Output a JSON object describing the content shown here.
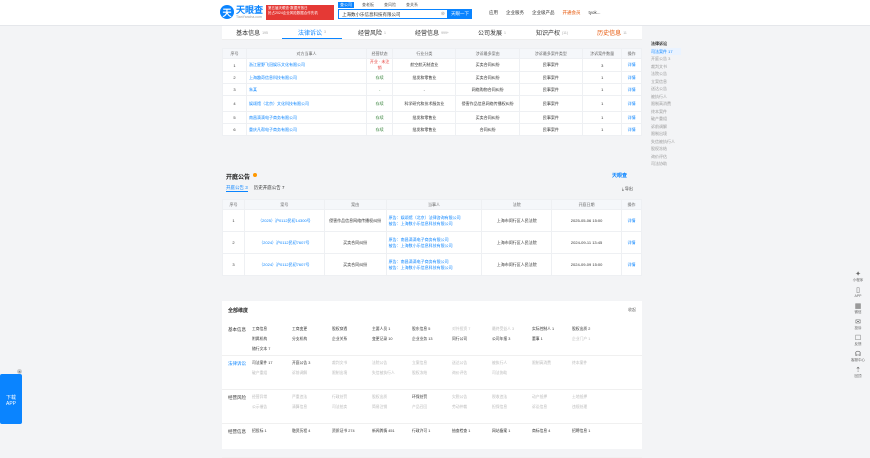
{
  "header": {
    "logo_name": "天眼查",
    "logo_domain": "TianYancha.com",
    "promo_line1": "第五届天眼查·数据开放日",
    "promo_line2": "抢占2024企业风险数据合作先机",
    "search_tabs": [
      "查公司",
      "查老板",
      "查风险",
      "查关系"
    ],
    "search_value": "上海数小乐信息科技有限公司",
    "search_btn": "天眼一下",
    "nav": [
      "应用",
      "企业服务",
      "企业级产品",
      "开通会员",
      "tyok..."
    ]
  },
  "tabs": [
    {
      "label": "基本信息",
      "count": "195"
    },
    {
      "label": "法律诉讼",
      "count": "3"
    },
    {
      "label": "经营风险",
      "count": "1"
    },
    {
      "label": "经营信息",
      "count": "999+"
    },
    {
      "label": "公司发展",
      "count": "1"
    },
    {
      "label": "知识产权",
      "count": "(11)"
    },
    {
      "label": "历史信息",
      "count": "11"
    }
  ],
  "lawsuit_table": {
    "headers": [
      "序号",
      "对方当事人",
      "经营状态",
      "行业分类",
      "涉诉最多案由",
      "涉诉最多案件类型",
      "涉诉案件数量",
      "操作"
    ],
    "rows": [
      [
        "1",
        "浙江星野飞冠娱乐文化有限公司",
        "开业 · 未注销",
        "航空航天制造业",
        "买卖合同纠纷",
        "民事案件",
        "3",
        "详情"
      ],
      [
        "2",
        "上海趣奇信息科技有限公司",
        "存续",
        "批发和零售业",
        "买卖合同纠纷",
        "民事案件",
        "1",
        "详情"
      ],
      [
        "3",
        "朱某",
        "-",
        "-",
        "网络购物合同纠纷",
        "民事案件",
        "1",
        "详情"
      ],
      [
        "4",
        "娱颂馆（北京）文化科技有限公司",
        "存续",
        "科学研究和技术服务业",
        "侵害作品信息网络传播权纠纷",
        "民事案件",
        "1",
        "详情"
      ],
      [
        "5",
        "南昌滴滴电子商务有限公司",
        "存续",
        "批发和零售业",
        "买卖合同纠纷",
        "民事案件",
        "1",
        "详情"
      ],
      [
        "6",
        "重庆凡帮电子商务有限公司",
        "存续",
        "批发和零售业",
        "合同纠纷",
        "民事案件",
        "1",
        "详情"
      ]
    ]
  },
  "court": {
    "title": "开庭公告",
    "subtabs": [
      "开庭公告 3",
      "历史开庭公告 7"
    ],
    "logo": "天眼查",
    "export": "导出",
    "headers": [
      "序号",
      "案号",
      "案由",
      "当事人",
      "法院",
      "开庭日期",
      "操作"
    ],
    "rows": [
      {
        "no": "1",
        "case": "（2025）沪0112民初14300号",
        "reason": "侵害作品信息网络传播权纠纷",
        "p1": "原告：娱颂馆（北京）法律咨询有限公司",
        "p2": "被告：上海数小乐信息科技有限公司",
        "court": "上海市闵行区人民法院",
        "date": "2025-05-06 15:00",
        "op": "详情"
      },
      {
        "no": "2",
        "case": "（2024）沪0112民初7607号",
        "reason": "买卖合同纠纷",
        "p1": "原告：南昌滴滴电子商务有限公司",
        "p2": "被告：上海数小乐信息科技有限公司",
        "court": "上海市闵行区人民法院",
        "date": "2024-09-11 13:45",
        "op": "详情"
      },
      {
        "no": "3",
        "case": "（2024）沪0112民初7607号",
        "reason": "买卖合同纠纷",
        "p1": "原告：南昌滴滴电子商务有限公司",
        "p2": "被告：上海数小乐信息科技有限公司",
        "court": "上海市闵行区人民法院",
        "date": "2024-09-09 15:00",
        "op": "详情"
      }
    ]
  },
  "overview": {
    "title": "全部维度",
    "collapse": "收起",
    "cats": [
      {
        "name": "基本信息",
        "blue": false,
        "items": [
          "工商信息",
          "工商变更",
          "股权穿透",
          "主要人员 1",
          "股东信息 5",
          "对外投资 7",
          "最终受益人 3",
          "实际控制人 1",
          "股权出质 2",
          "附属机构",
          "分支机构",
          "企业关系",
          "变更记录 10",
          "企业业务 13",
          "同行公司",
          "公司年报 3",
          "董事 1",
          "企业门户 1",
          "随行文本 7"
        ],
        "dim": [
          5,
          6,
          17
        ]
      },
      {
        "name": "法律诉讼",
        "blue": true,
        "items": [
          "司法案件 17",
          "开庭公告 3",
          "裁判文书",
          "法院公告",
          "立案信息",
          "送达公告",
          "被执行人",
          "限制高消费",
          "终本案件",
          "破产重组",
          "诉前调解",
          "限制出境",
          "失信被执行人",
          "股权冻结",
          "询价评估",
          "司法协助"
        ],
        "dim": [
          2,
          3,
          4,
          5,
          6,
          7,
          8,
          9,
          10,
          11,
          12,
          13,
          14,
          15
        ]
      },
      {
        "name": "经营风险",
        "blue": false,
        "items": [
          "经营异常",
          "严重违法",
          "行政处罚",
          "股权出质",
          "环保处罚",
          "欠税公告",
          "税收违法",
          "动产抵押",
          "土地抵押",
          "公示催告",
          "清算信息",
          "司法拍卖",
          "简易注销",
          "产品召回",
          "劳动仲裁",
          "担保信息",
          "诉讼信息",
          "违规处理"
        ],
        "dim": [
          0,
          1,
          2,
          3,
          5,
          6,
          7,
          8,
          9,
          10,
          11,
          12,
          13,
          14,
          15,
          16,
          17
        ]
      },
      {
        "name": "经营信息",
        "blue": false,
        "items": [
          "招投标 1",
          "融资历程 4",
          "资质证书 274",
          "新闻舆情 451",
          "行政许可 1",
          "抽查检查 1",
          "网站备案 1",
          "商标信息 4",
          "招聘信息 1"
        ],
        "dim": []
      }
    ]
  },
  "sidenav": {
    "head": "法律诉讼",
    "items": [
      "司法案件 17",
      "开庭公告 3",
      "裁判文书",
      "法院公告",
      "立案信息",
      "送达公告",
      "被执行人",
      "限制高消费",
      "终本案件",
      "破产重组",
      "诉前调解",
      "限制出境",
      "失信被执行人",
      "股权冻结",
      "询价评估",
      "司法协助"
    ]
  },
  "tools": [
    "小程序",
    "APP",
    "微信",
    "投诉",
    "反馈",
    "客服中心",
    "回顶"
  ],
  "download": {
    "line1": "下载",
    "line2": "APP"
  }
}
